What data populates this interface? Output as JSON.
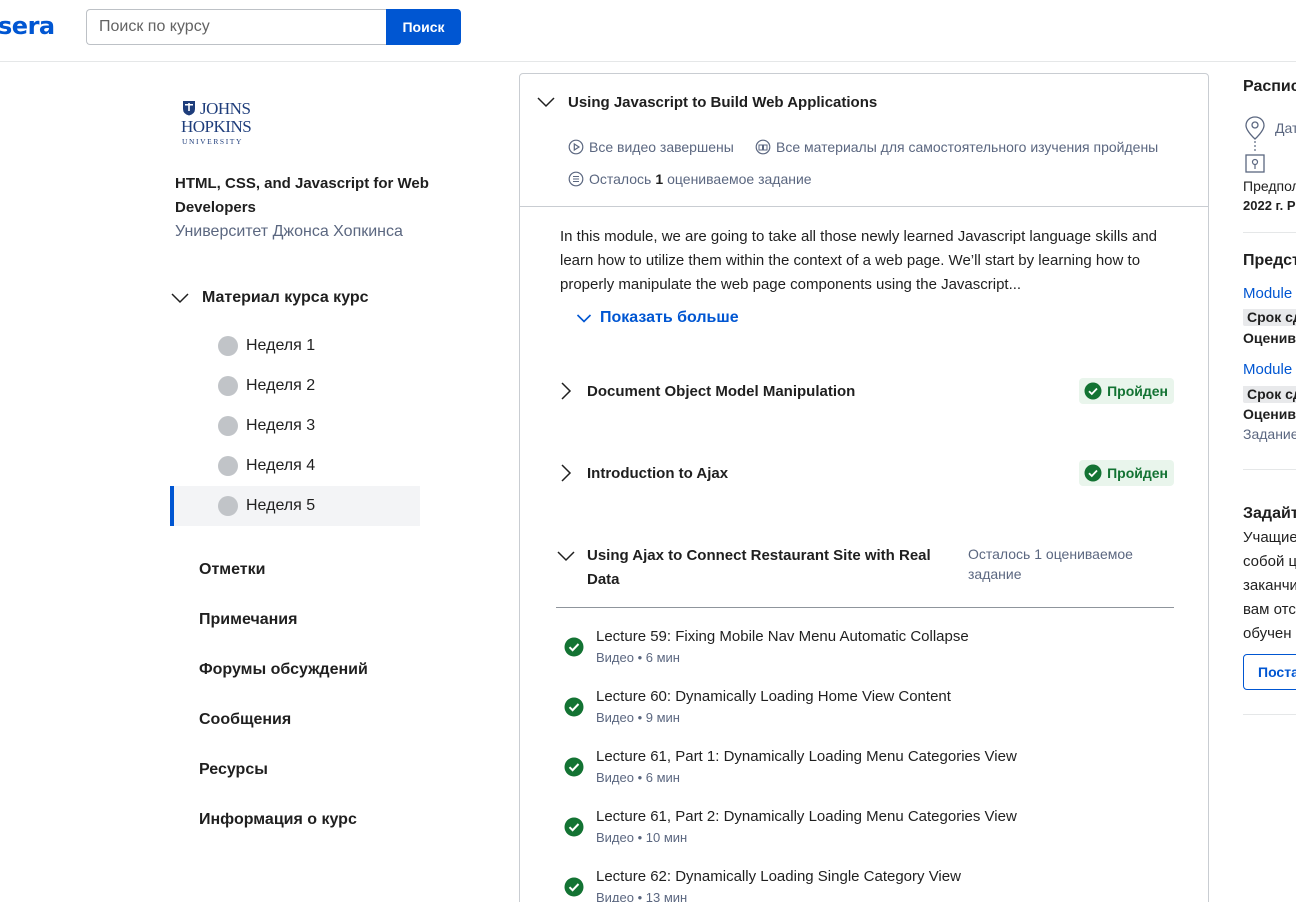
{
  "header": {
    "logo_text": "sera",
    "search_placeholder": "Поиск по курсу",
    "search_button": "Поиск"
  },
  "sidebar": {
    "logo": {
      "line1": "JOHNS",
      "line2": "HOPKINS",
      "line3": "UNIVERSITY"
    },
    "course_title": "HTML, CSS, and Javascript for Web Developers",
    "university": "Университет Джонса Хопкинса",
    "material_label": "Материал курса курс",
    "weeks": [
      {
        "label": "Неделя 1",
        "active": false
      },
      {
        "label": "Неделя 2",
        "active": false
      },
      {
        "label": "Неделя 3",
        "active": false
      },
      {
        "label": "Неделя 4",
        "active": false
      },
      {
        "label": "Неделя 5",
        "active": true
      }
    ],
    "links": [
      "Отметки",
      "Примечания",
      "Форумы обсуждений",
      "Сообщения",
      "Ресурсы",
      "Информация о курс"
    ]
  },
  "module": {
    "title": "Using Javascript to Build Web Applications",
    "videos_done": "Все видео завершены",
    "readings_done": "Все материалы для самостоятельного изучения пройдены",
    "remaining_prefix": "Осталось",
    "remaining_count": "1",
    "remaining_suffix": "оцениваемое задание",
    "description": "In this module, we are going to take all those newly learned Javascript language skills and learn how to utilize them within the context of a web page. We’ll start by learning how to properly manipulate the web page components using the Javascript...",
    "show_more": "Показать больше",
    "lessons": [
      {
        "title": "Document Object Model Manipulation",
        "status": "Пройден"
      },
      {
        "title": "Introduction to Ajax",
        "status": "Пройден"
      }
    ],
    "open_lesson": {
      "title": "Using Ajax to Connect Restaurant Site with Real Data",
      "remaining": "Осталось 1 оцениваемое задание"
    },
    "items": [
      {
        "title": "Lecture 59: Fixing Mobile Nav Menu Automatic Collapse",
        "meta": "Видео • 6 мин"
      },
      {
        "title": "Lecture 60: Dynamically Loading Home View Content",
        "meta": "Видео • 9 мин"
      },
      {
        "title": "Lecture 61, Part 1: Dynamically Loading Menu Categories View",
        "meta": "Видео • 6 мин"
      },
      {
        "title": "Lecture 61, Part 2: Dynamically Loading Menu Categories View",
        "meta": "Видео • 10 мин"
      },
      {
        "title": "Lecture 62: Dynamically Loading Single Category View",
        "meta": "Видео • 13 мин"
      }
    ]
  },
  "right": {
    "schedule_head": "Расписа",
    "date_label": "Дат",
    "pred_label": "Предпол",
    "pred_value": "2022 г. Р",
    "section_head": "Предст",
    "mod1_link": "Module",
    "mod1_chip": "Срок сд",
    "mod1_graded": "Оценив",
    "mod2_link": "Module",
    "mod2_chip": "Срок сд",
    "mod2_graded": "Оценив",
    "mod2_task": "Задание",
    "ask_head": "Задайт",
    "ask_lines": [
      "Учащие",
      "собой ц",
      "заканчи",
      "вам отс",
      "обучен"
    ],
    "ask_button": "Поста"
  },
  "colors": {
    "brand": "#0056d2",
    "success": "#137333",
    "success_bg": "#e9f5ec",
    "muted": "#5b6780"
  }
}
